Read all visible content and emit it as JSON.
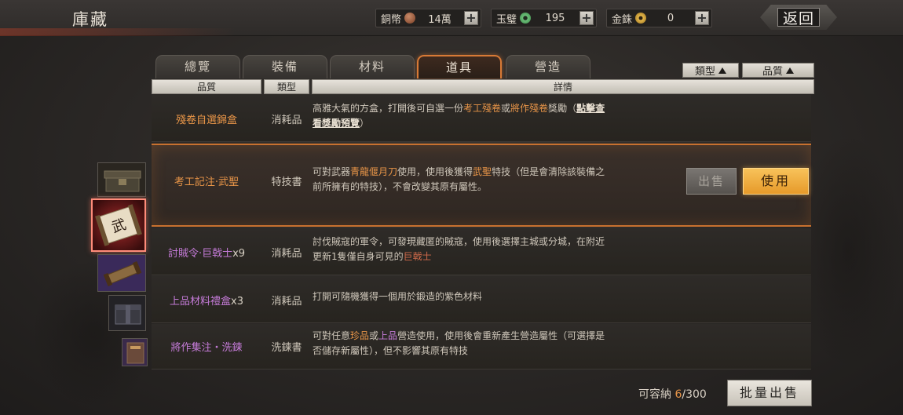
{
  "header": {
    "title": "庫藏",
    "back_label": "返回",
    "currencies": [
      {
        "label": "銅幣",
        "value": "14萬",
        "coin_color": "#9a5a3a"
      },
      {
        "label": "玉璧",
        "value": "195",
        "coin_color": "#5fae6a"
      },
      {
        "label": "金銖",
        "value": "0",
        "coin_color": "#d3a23a"
      }
    ]
  },
  "tabs": [
    {
      "label": "總覽"
    },
    {
      "label": "裝備"
    },
    {
      "label": "材料"
    },
    {
      "label": "道具"
    },
    {
      "label": "營造"
    }
  ],
  "active_tab": "道具",
  "sort": {
    "type_label": "類型",
    "quality_label": "品質"
  },
  "columns": {
    "quality": "品質",
    "type": "類型",
    "detail": "詳情"
  },
  "items": [
    {
      "name": "殘卷自選錦盒",
      "name_color": "#e89548",
      "type": "消耗品",
      "desc_parts": [
        "高雅大氣的方盒，打開後可自選一份",
        "考工殘卷",
        "或",
        "將作殘卷",
        "獎勵（",
        "點擊查看獎勵預覽",
        "）"
      ]
    },
    {
      "name": "考工記注·武聖",
      "name_color": "#e89548",
      "type": "特技書",
      "desc_parts": [
        "可對武器",
        "青龍偃月刀",
        "使用，使用後獲得",
        "武聖",
        "特技（但是會清除該裝備之前所擁有的特技），不會改變其原有屬性。"
      ],
      "sell_label": "出售",
      "use_label": "使用"
    },
    {
      "name": "討賊令·巨戟士",
      "count": "x9",
      "name_color": "#c57bd8",
      "type": "消耗品",
      "desc_parts": [
        "討伐賊寇的軍令，可發現藏匿的賊寇，使用後選擇主城或分城，在附近更新1隻僅自身可見的",
        "巨戟士"
      ]
    },
    {
      "name": "上品材料禮盒",
      "count": "x3",
      "name_color": "#c57bd8",
      "type": "消耗品",
      "desc_parts": [
        "打開可隨機獲得一個用於鍛造的紫色材料"
      ]
    },
    {
      "name": "將作集注・洗鍊",
      "name_color": "#c57bd8",
      "type": "洗鍊書",
      "desc_parts": [
        "可對任意",
        "珍品",
        "或",
        "上品",
        "營造使用，使用後會重新產生營造屬性（可選擇是否儲存新屬性），但不影響其原有特技"
      ]
    }
  ],
  "selected_item": "考工記注·武聖",
  "thumbnails": [
    {
      "name": "chest-icon"
    },
    {
      "name": "scroll-wu-icon"
    },
    {
      "name": "purple-scroll-icon"
    },
    {
      "name": "gift-box-icon"
    },
    {
      "name": "book-icon"
    }
  ],
  "thumb_glyph": "武",
  "footer": {
    "capacity_label": "可容納",
    "capacity_used": "6",
    "capacity_total": "/300",
    "bulk_sell_label": "批量出售"
  }
}
